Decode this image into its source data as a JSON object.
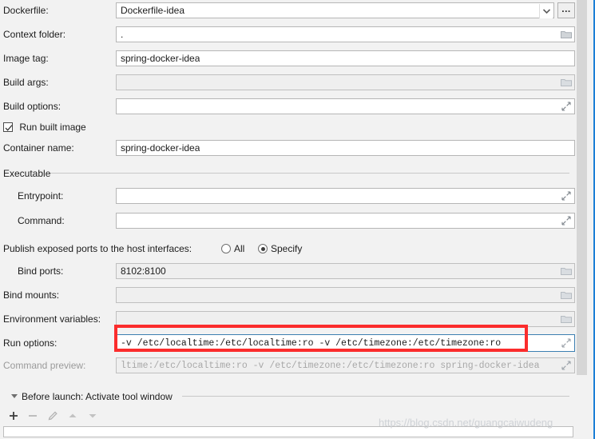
{
  "rows": {
    "dockerfile": {
      "label": "Dockerfile:",
      "value": "Dockerfile-idea"
    },
    "context": {
      "label": "Context folder:",
      "value": "."
    },
    "image_tag": {
      "label": "Image tag:",
      "value": "spring-docker-idea"
    },
    "build_args": {
      "label": "Build args:",
      "value": ""
    },
    "build_opts": {
      "label": "Build options:",
      "value": ""
    },
    "container": {
      "label": "Container name:",
      "value": "spring-docker-idea"
    },
    "entrypoint": {
      "label": "Entrypoint:",
      "value": ""
    },
    "command": {
      "label": "Command:",
      "value": ""
    },
    "bind_ports": {
      "label": "Bind ports:",
      "value": "8102:8100"
    },
    "bind_mounts": {
      "label": "Bind mounts:",
      "value": ""
    },
    "env_vars": {
      "label": "Environment variables:",
      "value": ""
    },
    "run_options": {
      "label": "Run options:",
      "value": "-v /etc/localtime:/etc/localtime:ro -v /etc/timezone:/etc/timezone:ro"
    },
    "cmd_preview": {
      "label": "Command preview:",
      "value": "ltime:/etc/localtime:ro -v /etc/timezone:/etc/timezone:ro spring-docker-idea"
    }
  },
  "checkbox": {
    "label": "Run built image",
    "checked": true
  },
  "groups": {
    "executable": "Executable"
  },
  "ports": {
    "label": "Publish exposed ports to the host interfaces:",
    "options": [
      {
        "label": "All",
        "selected": false
      },
      {
        "label": "Specify",
        "selected": true
      }
    ]
  },
  "before_launch": {
    "title": "Before launch: Activate tool window",
    "buttons": [
      "add",
      "remove",
      "edit",
      "move-up",
      "move-down"
    ]
  },
  "browse_button": {
    "label": "..."
  },
  "watermark": "https://blog.csdn.net/guangcaiwudeng",
  "colors": {
    "background": "#f2f2f2",
    "field_border": "#b6b6b6",
    "field_disabled": "#efefef",
    "focus_border": "#3c7fb1",
    "annotation_red": "#fb2c2c",
    "accent_blue": "#1c7fd6",
    "disabled_text": "#9a9a9a"
  }
}
